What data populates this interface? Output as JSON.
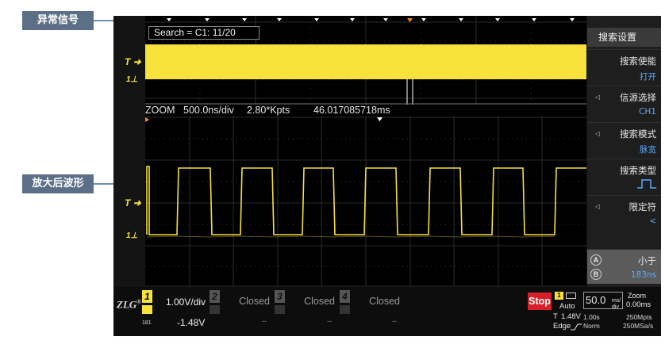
{
  "callouts": {
    "top_label": "异常信号",
    "bottom_label": "放大后波形"
  },
  "overview": {
    "search_text": "Search = C1: 11/20",
    "trigger_marker": "T",
    "channel_marker": "1"
  },
  "zoom": {
    "title": "ZOOM",
    "timescale": "500.0ns/div",
    "points": "2.80*Kpts",
    "time": "46.017085718ms",
    "trigger_marker": "T",
    "channel_marker": "1"
  },
  "menu": {
    "title": "搜索设置",
    "items": [
      {
        "label": "搜索使能",
        "value": "打开"
      },
      {
        "label": "信源选择",
        "value": "CH1"
      },
      {
        "label": "搜索模式",
        "value": "脉宽"
      },
      {
        "label": "搜索类型",
        "value": ""
      },
      {
        "label": "限定符",
        "value": "<"
      },
      {
        "label": "小于",
        "value": "183ns"
      }
    ],
    "btn_a": "A",
    "btn_b": "B"
  },
  "bottom": {
    "logo": "ZLG",
    "logo_reg": "®",
    "ch1": {
      "num": "1",
      "volts": "1.00V/div",
      "offset": "-1.48V",
      "bw": "181"
    },
    "channels": [
      {
        "num": "2",
        "status": "Closed",
        "value": "--"
      },
      {
        "num": "3",
        "status": "Closed",
        "value": "--"
      },
      {
        "num": "4",
        "status": "Closed",
        "value": "--"
      }
    ],
    "run_state": "Stop",
    "trigger": {
      "source": "1",
      "mode": "Auto",
      "label": "T",
      "level": "1.48V",
      "type": "Edge"
    },
    "timebase": {
      "value": "50.0",
      "unit_top": "ms/",
      "unit_bottom": "div",
      "zoom_label": "Zoom",
      "zoom_value": "0.00ms",
      "row1_left": "1.00s",
      "row1_right": "250Mpts",
      "row2_left": "Norm",
      "row2_right": "250MSa/s"
    }
  },
  "colors": {
    "channel1": "#f7e13a",
    "stop": "#d61f26",
    "menu_value": "#5aa9ff",
    "callout": "#5b6f87"
  }
}
